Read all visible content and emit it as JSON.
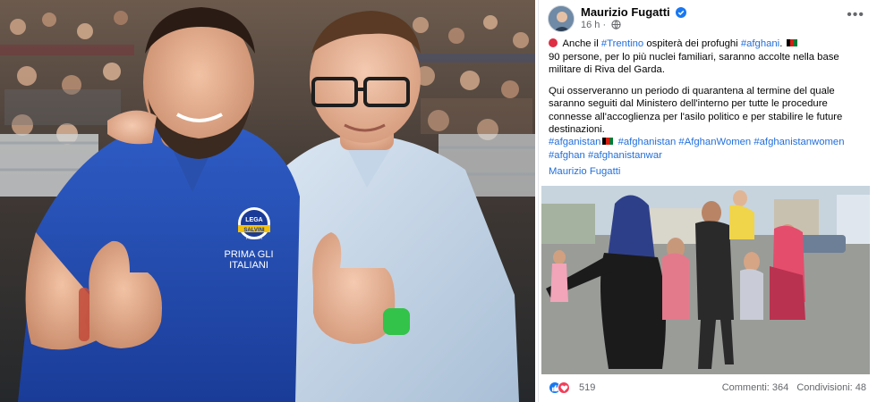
{
  "post": {
    "author": "Maurizio Fugatti",
    "time": "16 h",
    "time_sep": "·",
    "more_label": "•••",
    "line1_prefix": "Anche il",
    "line1_tag_trentino": "#Trentino",
    "line1_mid": "ospiterà dei profughi",
    "line1_tag_afghani": "#afghani",
    "line1_end": ".",
    "line2": "90 persone, per lo più nuclei familiari, saranno accolte nella base militare di Riva del Garda.",
    "paragraph2": "Qui osserveranno un periodo di quarantena al termine del quale saranno seguiti dal Ministero dell'interno per tutte le procedure connesse all'accoglienza per l'asilo politico e per stabilire le future destinazioni.",
    "hashtags": [
      "#afganistan",
      "#afghanistan",
      "#AfghanWomen",
      "#afghanistanwomen",
      "#afghan",
      "#afghanistanwar"
    ],
    "signature": "Maurizio Fugatti",
    "reaction_count": "519",
    "comments": "Commenti: 364",
    "shares": "Condivisioni: 48"
  },
  "left_photo": {
    "shirt_logo_top": "LEGA",
    "shirt_logo_mid": "SALVINI",
    "shirt_logo_sub": "PREMIER",
    "shirt_text_1": "PRIMA GLI",
    "shirt_text_2": "ITALIANI"
  },
  "colors": {
    "link": "#216fdb",
    "muted": "#65676b",
    "verified": "#1877f2",
    "like": "#1877f2",
    "love": "#f33e58",
    "red_dot": "#dd2e44"
  },
  "icons": [
    "verified-badge-icon",
    "globe-icon",
    "more-options-icon",
    "red-circle-icon",
    "afghan-flag-icon",
    "like-reaction-icon",
    "love-reaction-icon"
  ]
}
